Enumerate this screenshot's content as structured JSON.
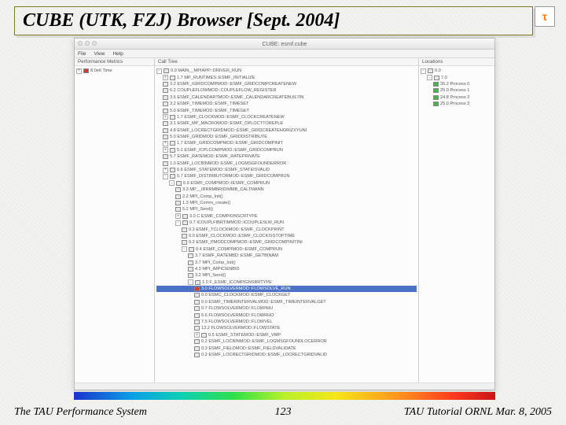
{
  "slide": {
    "title": "CUBE (UTK, FZJ) Browser [Sept. 2004]",
    "footer_left": "The TAU Performance System",
    "footer_page": "123",
    "footer_right": "TAU Tutorial ORNL Mar. 8, 2005",
    "tau_logo": "τ"
  },
  "app": {
    "window_title": "CUBE: esmf.cube",
    "menu": {
      "file": "File",
      "view": "View",
      "help": "Help"
    },
    "columns": {
      "left_header": "Performance Metrics",
      "mid_header": "Call Tree",
      "right_header": "Locations"
    },
    "left": {
      "root": "8.0e6 Time"
    },
    "right": {
      "root": "0.0",
      "node0": "7.0",
      "p0": "35.2  Process 0",
      "p1": "25.0  Process 1",
      "p2": "24.8  Process 2",
      "p3": "25.0  Process 3"
    },
    "mid": [
      {
        "ind": 0,
        "exp": "-",
        "sw": "gry",
        "t": "0.0 MAIN__MPIAPP::DRIVER_RUN"
      },
      {
        "ind": 1,
        "exp": "+",
        "sw": "gry",
        "t": "1.7 MP_RUNTIMES::ESMF_INITIALIZE"
      },
      {
        "ind": 1,
        "exp": "",
        "sw": "gry",
        "t": "3.2 ESMF_IGRIDCOMPMOD::ESMF_GRIDCOMPCREATENEW"
      },
      {
        "ind": 1,
        "exp": "",
        "sw": "gry",
        "t": "6.2 COUPLEFLOWMOD::COUPLEFLOW_REGISTER"
      },
      {
        "ind": 1,
        "exp": "",
        "sw": "gry",
        "t": "3.6 ESMF_CALENDARTMOD::ESMF_CALENDARCREATEBUILTIN"
      },
      {
        "ind": 1,
        "exp": "",
        "sw": "gry",
        "t": "3.2 ESMF_TIMEMOD::ESMF_TIMESET"
      },
      {
        "ind": 1,
        "exp": "",
        "sw": "gry",
        "t": "5.0 ESMF_TIMEMOD::ESMF_TIMEGET"
      },
      {
        "ind": 1,
        "exp": "+",
        "sw": "gry",
        "t": "1.7 ESMF_CLOCKMOD::ESMF_CLOCKCREATENEW"
      },
      {
        "ind": 1,
        "exp": "",
        "sw": "gry",
        "t": "3.1 ESMF_MP_MACROMOD::ESMF_OPLOCTTOREPLE"
      },
      {
        "ind": 1,
        "exp": "",
        "sw": "gry",
        "t": "4.8 ESMF_LOCRECTGRIDMOD::ESMF_GRIDCREATEHORIZXYUNI"
      },
      {
        "ind": 1,
        "exp": "",
        "sw": "gry",
        "t": "5.0 ESMF_GRIDMOD::ESMF_GRIDDISTRIBUTE"
      },
      {
        "ind": 1,
        "exp": "+",
        "sw": "gry",
        "t": "1.7 ESMF_GRIDCOMPMOD::ESMF_GRIDCOMPINIT"
      },
      {
        "ind": 1,
        "exp": "+",
        "sw": "gry",
        "t": "5.1 ESMF_ICPLCOMPMOD::ESMF_GRIDCOMPRUN"
      },
      {
        "ind": 1,
        "exp": "",
        "sw": "gry",
        "t": "5.7 ESMF_RATEMOD::ESMF_RATEPRIVATE"
      },
      {
        "ind": 1,
        "exp": "",
        "sw": "gry",
        "t": "1.0 ESMF_LOCBINMOD::ESMF_LOGMSGFOUNDERROR"
      },
      {
        "ind": 1,
        "exp": "+",
        "sw": "gry",
        "t": "0.6 ESMF_STATEMOD::ESMF_STATEISVALID"
      },
      {
        "ind": 1,
        "exp": "-",
        "sw": "gry",
        "t": "0.7 ESMF_DISTRIBUTORMOD::ESMF_GRIDCOMPRUN"
      },
      {
        "ind": 2,
        "exp": "-",
        "sw": "gry",
        "t": "6.9 ESMF_COMPMOD::IESMF_COMPRUN"
      },
      {
        "ind": 3,
        "exp": "",
        "sw": "gry",
        "t": "3.3 MP__IRRRMBRID/MMB_CALTMANN"
      },
      {
        "ind": 3,
        "exp": "",
        "sw": "gry",
        "t": "2.2 MPI_Comp_Init()"
      },
      {
        "ind": 3,
        "exp": "",
        "sw": "gry",
        "t": "1.3 MPI_Comm_create()"
      },
      {
        "ind": 3,
        "exp": "",
        "sw": "gry",
        "t": "5.2 MPI_Send()"
      },
      {
        "ind": 3,
        "exp": "+",
        "sw": "gry",
        "t": "3.0 C ESMF_COMPIONSCRTYPE"
      },
      {
        "ind": 3,
        "exp": "-",
        "sw": "gry",
        "t": "0.7 ICOUPLFIBRTIMMOD::ICOUPLESLW_RUN"
      },
      {
        "ind": 4,
        "exp": "",
        "sw": "gry",
        "t": "0.3 ESMF_TCLOCKMOD::ESMF_CLOCKPRINT"
      },
      {
        "ind": 4,
        "exp": "",
        "sw": "gry",
        "t": "0.0 ESMF_CLOCKMOD::ESMF_CLOCKISSTOPTIME"
      },
      {
        "ind": 4,
        "exp": "",
        "sw": "gry",
        "t": "0.2 ESMF_PMODCOMPMOD::ESMF_GRIDCOMPINITINI"
      },
      {
        "ind": 4,
        "exp": "-",
        "sw": "gry",
        "t": "0.4 ESMF_COMPIMOD::ESMF_COMPRUN"
      },
      {
        "ind": 5,
        "exp": "",
        "sw": "gry",
        "t": "3.7 ESMF_RATEMBD::ESMF_GETBINAM"
      },
      {
        "ind": 5,
        "exp": "",
        "sw": "gry",
        "t": "3.7 MPI_Comp_Init()"
      },
      {
        "ind": 5,
        "exp": "",
        "sw": "gry",
        "t": "4.3 MPI_IMPICIENBID"
      },
      {
        "ind": 5,
        "exp": "",
        "sw": "gry",
        "t": "3.2 MPI_Send()"
      },
      {
        "ind": 5,
        "exp": "-",
        "sw": "gry",
        "t": "1.0 F_ESMF_ICOMPIGNSBRTYPE"
      },
      {
        "ind": 6,
        "exp": "",
        "sw": "red",
        "t": "3.0 FLOWSOLVERMOD::FLOWSOLVE_RUN",
        "hl": true
      },
      {
        "ind": 6,
        "exp": "",
        "sw": "gry",
        "t": "0.0 ESMC_CLOCKMOD::ESMF_CLOCKGET"
      },
      {
        "ind": 6,
        "exp": "",
        "sw": "gry",
        "t": "0.0 ESMF_TIMERINTERVALMOD::ESMF_TIMEINTERVALGET"
      },
      {
        "ind": 6,
        "exp": "",
        "sw": "gry",
        "t": "0.7 FLOWSOLVERMOD::FLOWINIU"
      },
      {
        "ind": 6,
        "exp": "",
        "sw": "gry",
        "t": "6.6 FLOWSOLVERMOD::FLOWRHO"
      },
      {
        "ind": 6,
        "exp": "",
        "sw": "gry",
        "t": "7.5 FLOWSOLVERMOD::FLOWVEL"
      },
      {
        "ind": 6,
        "exp": "",
        "sw": "gry",
        "t": "13.2 FLOWSOLVERMOD::FLOWSTATE"
      },
      {
        "ind": 6,
        "exp": "+",
        "sw": "gry",
        "t": "0.5 ESMF_STATEMOD::ESMF_VMP"
      },
      {
        "ind": 6,
        "exp": "",
        "sw": "gry",
        "t": "0.2 ESMF_LOCBINMOD::ESMF_LOGMSGFOUNDLOCERROR"
      },
      {
        "ind": 6,
        "exp": "",
        "sw": "gry",
        "t": "0.3 ESMF_FIELDMOD::ESMF_FIELDVALIDATE"
      },
      {
        "ind": 6,
        "exp": "",
        "sw": "gry",
        "t": "0.2 ESMF_LOCRECTGRIDMOD::ESMF_LOCRECTGRIDVALID"
      }
    ]
  }
}
